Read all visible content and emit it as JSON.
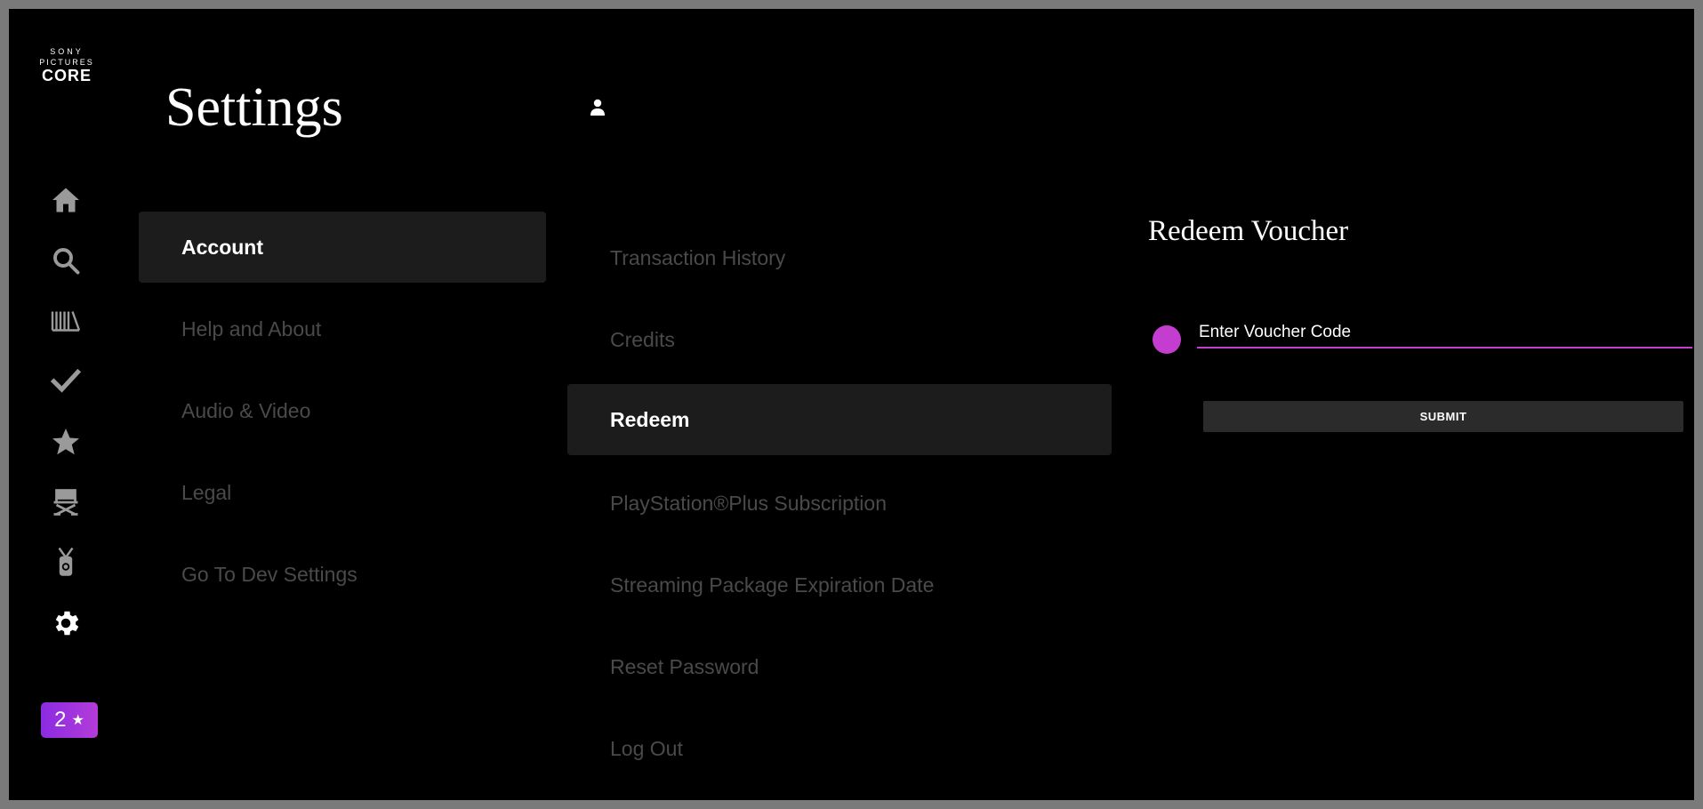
{
  "brand": {
    "logo_line1": "SONY",
    "logo_line2": "PICTURES",
    "logo_line3": "CORE"
  },
  "rail": {
    "icons": [
      "home-icon",
      "search-icon",
      "library-icon",
      "check-icon",
      "star-icon",
      "director-chair-icon",
      "lanyard-pass-icon",
      "gear-icon"
    ],
    "active_icon": "gear-icon",
    "rating_badge": {
      "value": "2",
      "star": "★"
    }
  },
  "header": {
    "title": "Settings"
  },
  "menu": {
    "items": [
      {
        "label": "Account",
        "active": true
      },
      {
        "label": "Help and About",
        "active": false
      },
      {
        "label": "Audio & Video",
        "active": false
      },
      {
        "label": "Legal",
        "active": false
      },
      {
        "label": "Go To Dev Settings",
        "active": false
      }
    ]
  },
  "submenu": {
    "items": [
      {
        "label": "Transaction History",
        "active": false
      },
      {
        "label": "Credits",
        "active": false
      },
      {
        "label": "Redeem",
        "active": true
      },
      {
        "label": "PlayStation®Plus Subscription",
        "active": false
      },
      {
        "label": "Streaming Package Expiration Date",
        "active": false
      },
      {
        "label": "Reset Password",
        "active": false
      },
      {
        "label": "Log Out",
        "active": false
      }
    ]
  },
  "redeem": {
    "title": "Redeem Voucher",
    "input_placeholder": "Enter Voucher Code",
    "submit_label": "SUBMIT"
  },
  "colors": {
    "accent": "#c53cd0",
    "active_bg": "#1c1c1c",
    "inactive_text": "#4a4a4a",
    "badge_gradient_start": "#8a2be2",
    "badge_gradient_end": "#b43cd8"
  }
}
